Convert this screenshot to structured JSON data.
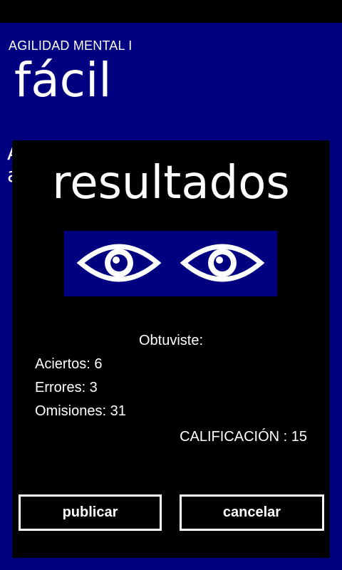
{
  "app": {
    "title": "AGILIDAD MENTAL I",
    "page_title": "fácil",
    "background_text": "A\na"
  },
  "dialog": {
    "title": "resultados",
    "eyes_icon": "eyes-icon",
    "obtuviste_label": "Obtuviste:",
    "aciertos": "Aciertos: 6",
    "errores": "Errores: 3",
    "omisiones": "Omisiones: 31",
    "calificacion": "CALIFICACIÓN : 15",
    "buttons": {
      "publicar": "publicar",
      "cancelar": "cancelar"
    }
  },
  "colors": {
    "page_background": "#000080",
    "dialog_background": "#000000",
    "text": "#ffffff"
  }
}
